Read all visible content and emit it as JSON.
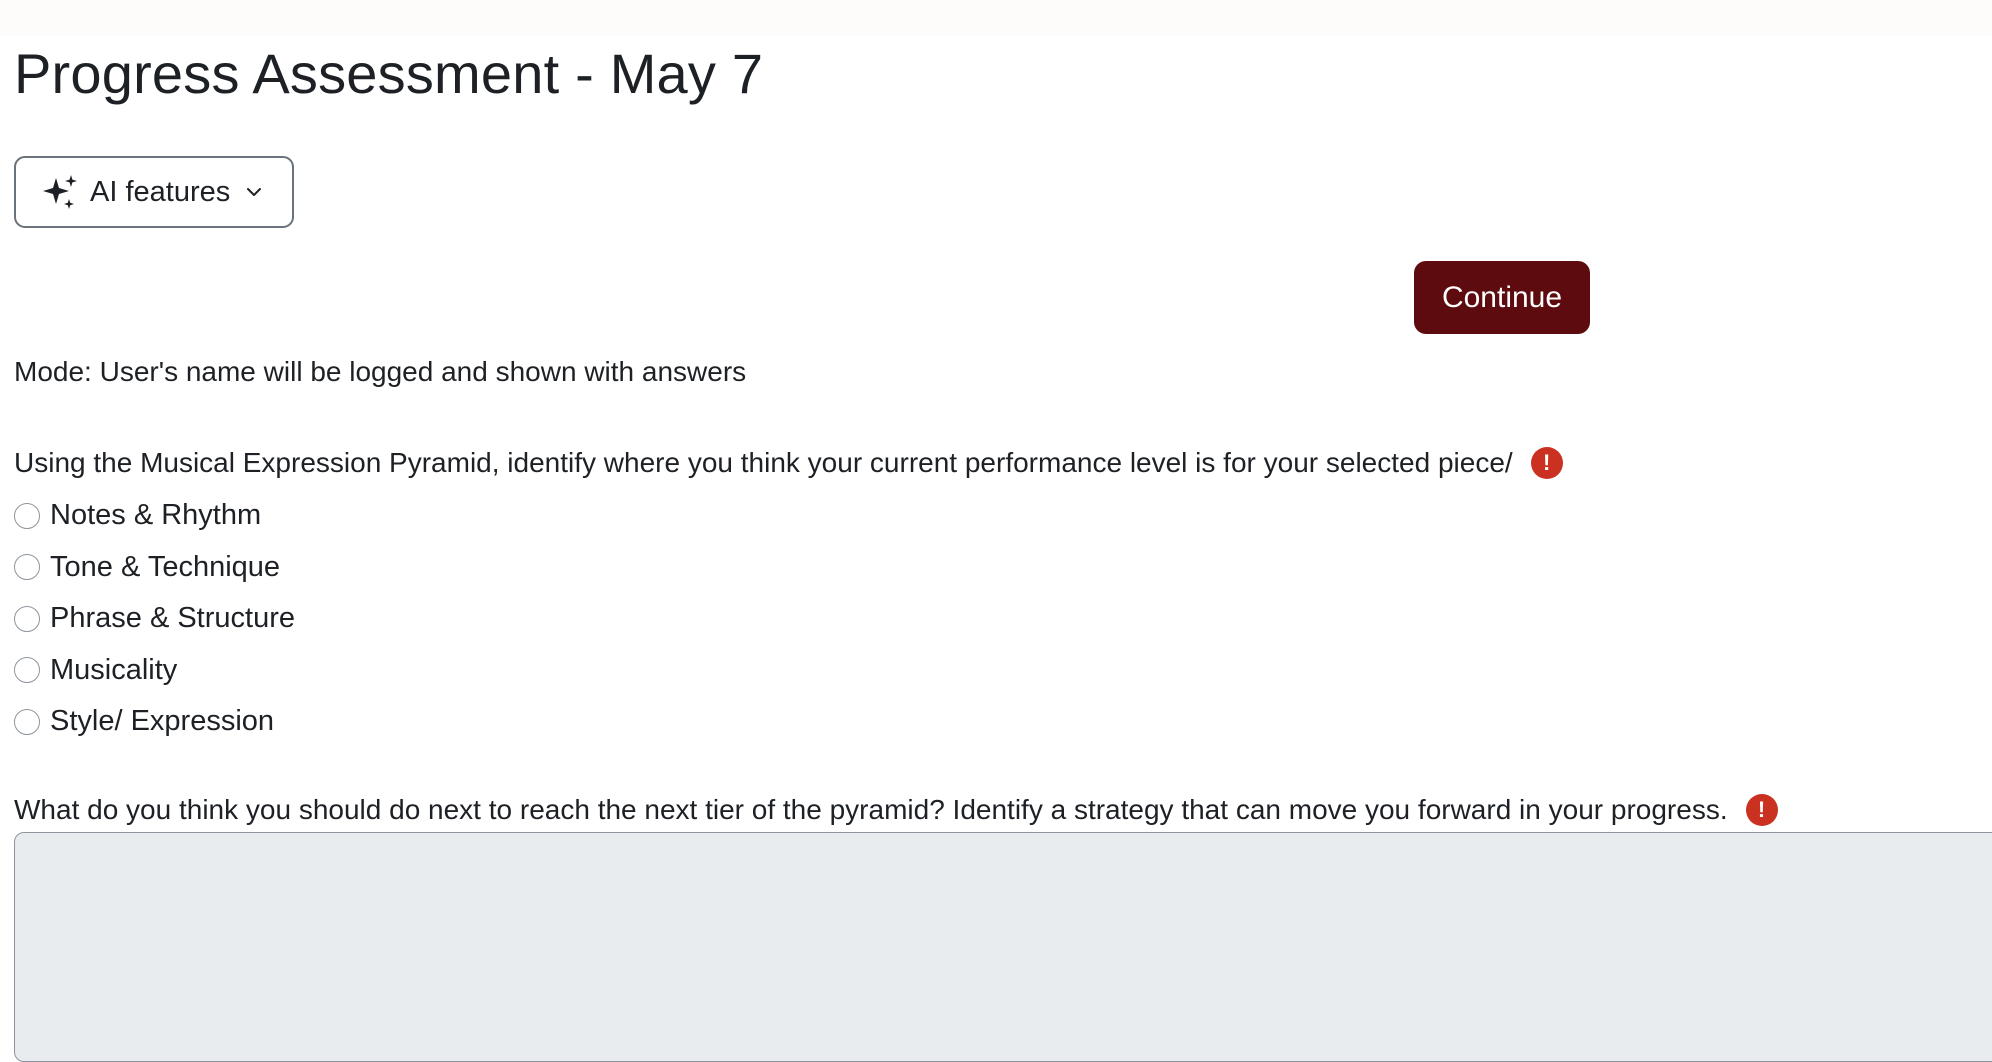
{
  "page": {
    "title": "Progress Assessment - May 7"
  },
  "ai_features": {
    "label": "AI features",
    "icon": "sparkles-icon"
  },
  "continue_button": {
    "label": "Continue",
    "color": "#5d0b0f"
  },
  "mode_text": "Mode: User's name will be logged and shown with answers",
  "questions": [
    {
      "text": "Using the Musical Expression Pyramid, identify where you think your current performance level is for your selected piece/",
      "required": true,
      "type": "radio",
      "options": [
        "Notes & Rhythm",
        "Tone & Technique",
        "Phrase & Structure",
        "Musicality",
        "Style/ Expression"
      ]
    },
    {
      "text": "What do you think you should do next to reach the next tier of the pyramid? Identify a strategy that can move you forward in your progress.",
      "required": true,
      "type": "textarea",
      "value": ""
    }
  ],
  "colors": {
    "required_icon": "#ca3120",
    "textarea_bg": "#e9ecef"
  }
}
